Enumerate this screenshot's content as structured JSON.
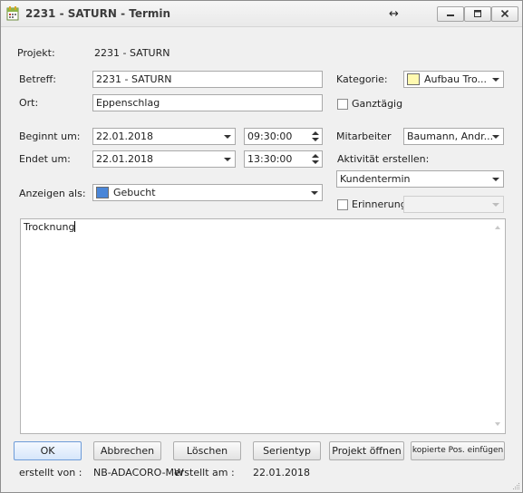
{
  "window": {
    "title": "2231 - SATURN - Termin"
  },
  "labels": {
    "projekt": "Projekt:",
    "betreff": "Betreff:",
    "ort": "Ort:",
    "beginnt": "Beginnt um:",
    "endet": "Endet um:",
    "anzeigen": "Anzeigen als:",
    "kategorie": "Kategorie:",
    "ganztaegig": "Ganztägig",
    "mitarbeiter": "Mitarbeiter",
    "aktivitaet": "Aktivität erstellen:",
    "erinnerung": "Erinnerung",
    "erstellt_von": "erstellt von :",
    "erstellt_am": "erstellt am :"
  },
  "values": {
    "projekt": "2231 - SATURN",
    "betreff": "2231 - SATURN",
    "ort": "Eppenschlag",
    "start_date": "22.01.2018",
    "start_time": "09:30:00",
    "end_date": "22.01.2018",
    "end_time": "13:30:00",
    "anzeigen": "Gebucht",
    "kategorie": "Aufbau Tro...",
    "mitarbeiter": "Baumann, Andr...",
    "aktivitaet": "Kundentermin",
    "erinnerung": "",
    "ganztaegig_checked": false,
    "erinnerung_checked": false,
    "notes": "Trocknung",
    "erstellt_von": "NB-ADACORO-MW",
    "erstellt_am": "22.01.2018"
  },
  "colors": {
    "anzeigen_swatch": "#4a86d8",
    "kategorie_swatch": "#fff9b0"
  },
  "buttons": {
    "ok": "OK",
    "abbrechen": "Abbrechen",
    "loeschen": "Löschen",
    "serientyp": "Serientyp",
    "projekt_oeffnen": "Projekt öffnen",
    "kopierte_pos": "kopierte Pos. einfügen"
  }
}
